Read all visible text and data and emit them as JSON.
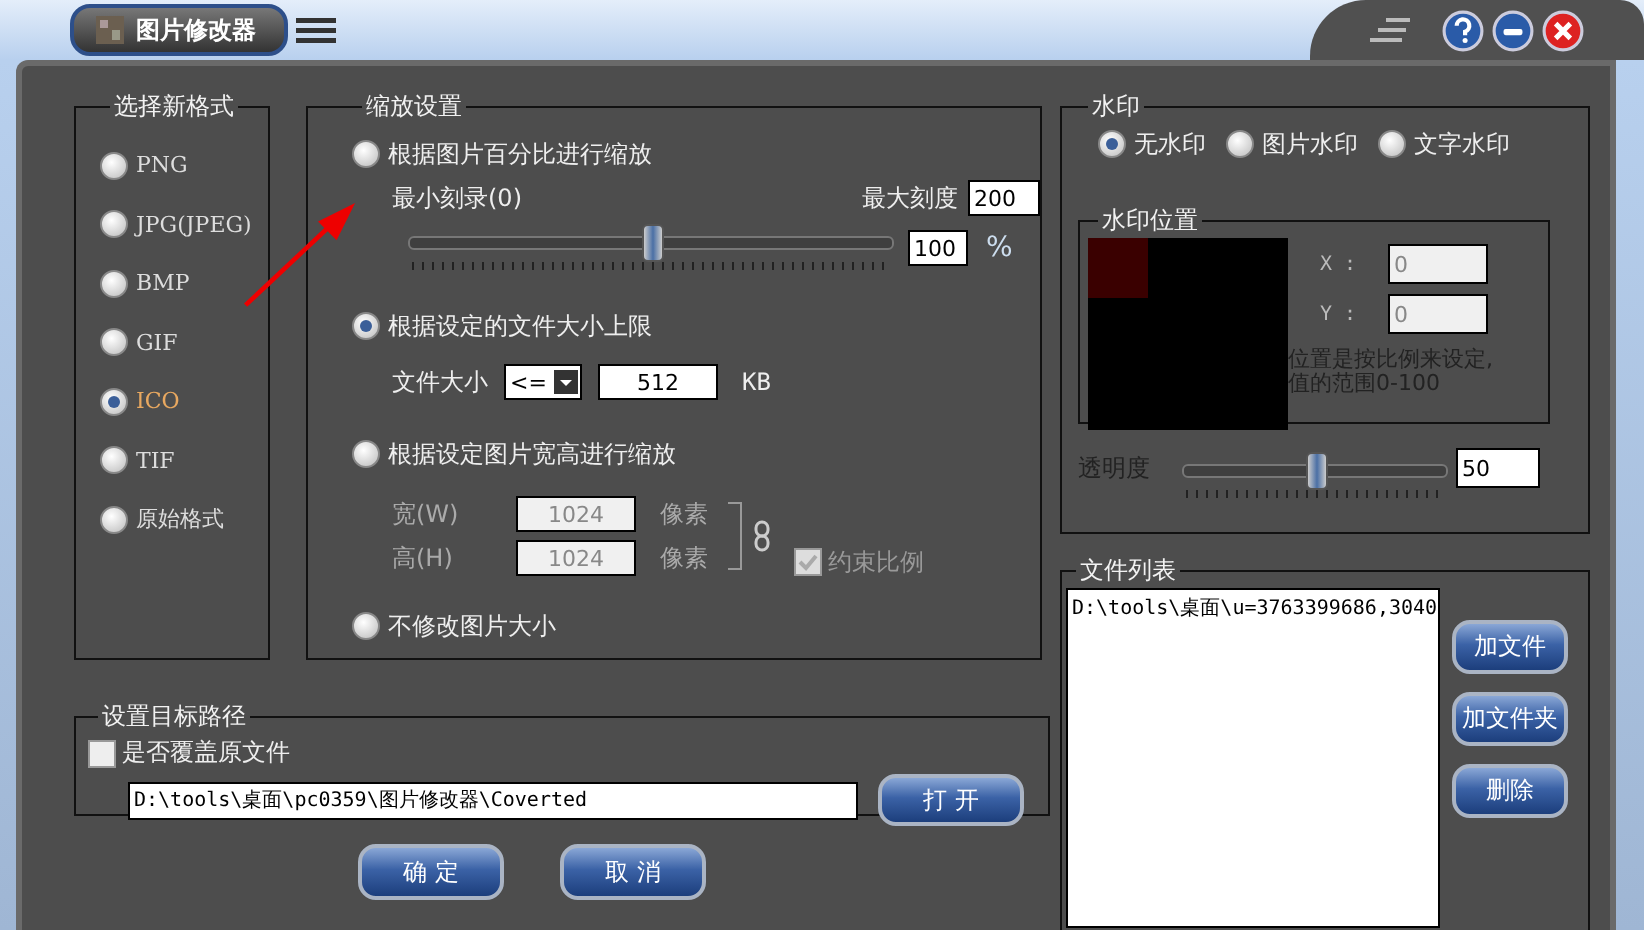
{
  "window": {
    "title": "图片修改器"
  },
  "formats": {
    "title": "选择新格式",
    "options": [
      {
        "label": "PNG",
        "selected": false
      },
      {
        "label": "JPG(JPEG)",
        "selected": false
      },
      {
        "label": "BMP",
        "selected": false
      },
      {
        "label": "GIF",
        "selected": false
      },
      {
        "label": "ICO",
        "selected": true
      },
      {
        "label": "TIF",
        "selected": false
      },
      {
        "label": "原始格式",
        "selected": false
      }
    ]
  },
  "scaling": {
    "title": "缩放设置",
    "modes": [
      {
        "kind": "percent",
        "label": "根据图片百分比进行缩放",
        "selected": false,
        "min_label": "最小刻录(0)",
        "max_label": "最大刻度",
        "max_value": "200",
        "level": 0.5,
        "value": "100",
        "unit": "%"
      },
      {
        "kind": "filesize",
        "label": "根据设定的文件大小上限",
        "selected": true,
        "size_label": "文件大小",
        "compare": "<=",
        "value": "512",
        "unit": "KB"
      },
      {
        "kind": "dimensions",
        "label": "根据设定图片宽高进行缩放",
        "selected": false,
        "width_label": "宽(W)",
        "width_value": "1024",
        "width_unit": "像素",
        "height_label": "高(H)",
        "height_value": "1024",
        "height_unit": "像素",
        "keep_ratio": {
          "label": "约束比例",
          "checked": true,
          "disabled": true
        }
      },
      {
        "kind": "none",
        "label": "不修改图片大小",
        "selected": false
      }
    ]
  },
  "target": {
    "title": "设置目标路径",
    "overwrite": {
      "label": "是否覆盖原文件",
      "checked": false
    },
    "path": "D:\\tools\\桌面\\pc0359\\图片修改器\\Coverted",
    "open_button": "打 开"
  },
  "actions": [
    "确 定",
    "取 消"
  ],
  "watermark": {
    "title": "水印",
    "types": [
      {
        "label": "无水印",
        "selected": true
      },
      {
        "label": "图片水印",
        "selected": false
      },
      {
        "label": "文字水印",
        "selected": false
      }
    ],
    "position": {
      "title": "水印位置",
      "x_label": "X :",
      "x_value": "0",
      "y_label": "Y :",
      "y_value": "0",
      "hint": [
        "位置是按比例来设定,",
        "值的范围0-100"
      ]
    },
    "opacity": {
      "label": "透明度",
      "level": 0.5,
      "value": "50"
    }
  },
  "file_list": {
    "title": "文件列表",
    "items": [
      "D:\\tools\\桌面\\u=3763399686,3040"
    ],
    "buttons": [
      "加文件",
      "加文件夹",
      "删除"
    ]
  }
}
